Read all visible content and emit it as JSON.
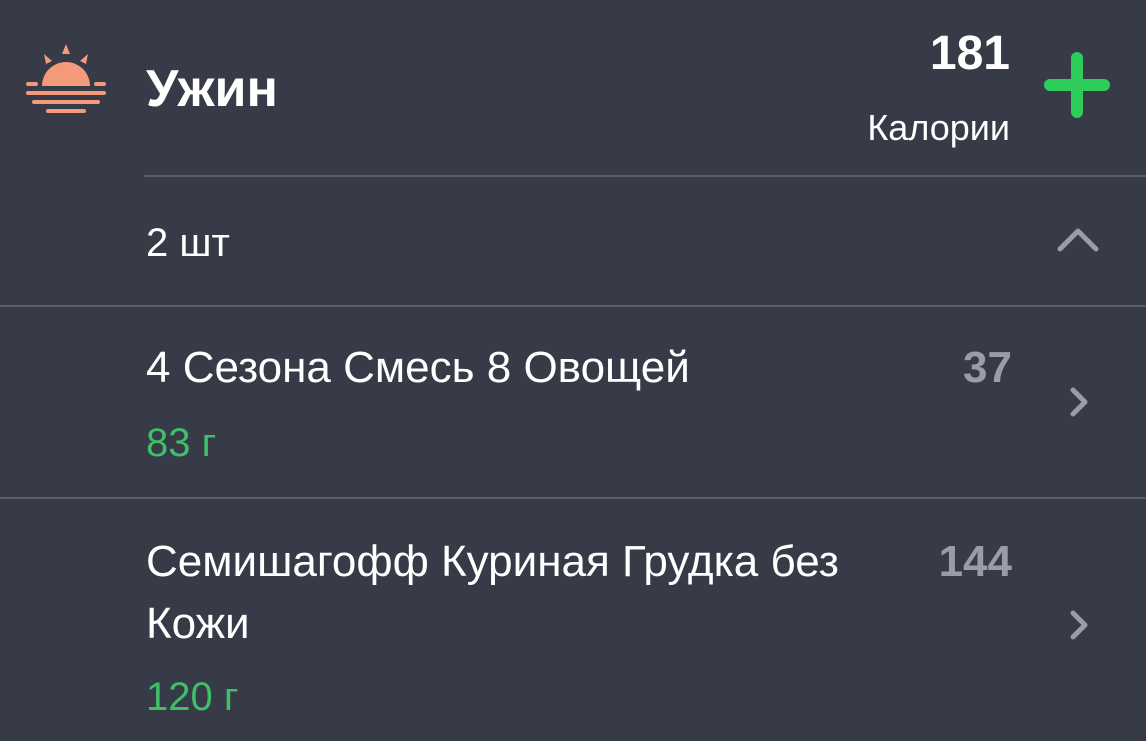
{
  "meal": {
    "title": "Ужин",
    "icon": "sunset-icon",
    "calories_value": "181",
    "calories_label": "Калории",
    "add_icon": "plus-icon"
  },
  "summary": {
    "count": "2 шт",
    "toggle_icon": "chevron-up-icon"
  },
  "items": [
    {
      "name": "4 Сезона Смесь 8 Овощей",
      "calories": "37",
      "weight": "83 г"
    },
    {
      "name": "Семишагофф Куриная Грудка без Кожи",
      "calories": "144",
      "weight": "120 г"
    }
  ],
  "colors": {
    "background": "#373a47",
    "accent_green": "#3fbf6a",
    "add_green": "#2ecc5a",
    "sun_orange": "#f39a7a",
    "muted_text": "#9a9ca8"
  }
}
